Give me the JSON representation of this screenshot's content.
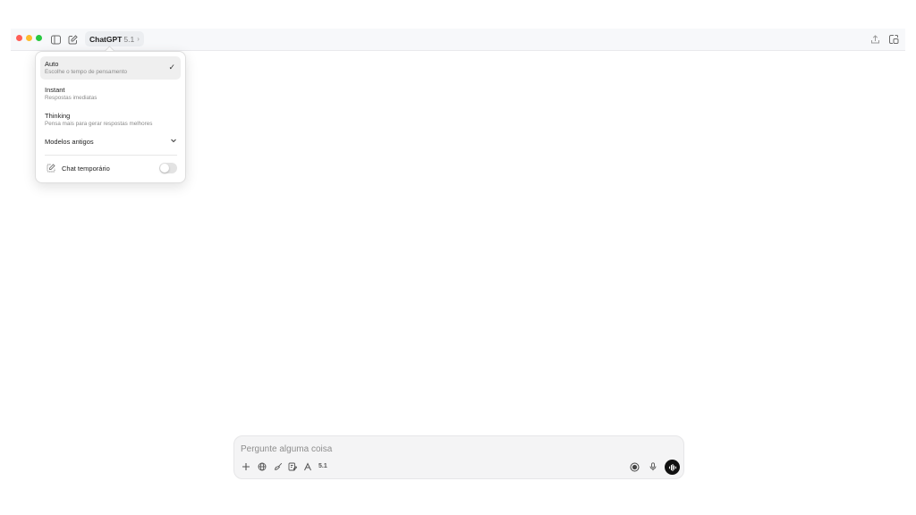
{
  "titlebar": {
    "model_name": "ChatGPT",
    "model_version": "5.1",
    "model_chevron": "›",
    "traffic_colors": {
      "close": "#ff5f57",
      "minimize": "#febc2e",
      "zoom": "#28c840"
    },
    "icons": [
      "sidebar-toggle-icon",
      "new-chat-icon",
      "share-icon",
      "new-window-icon"
    ]
  },
  "model_menu": {
    "options": [
      {
        "title": "Auto",
        "subtitle": "Escolhe o tempo de pensamento",
        "selected": true
      },
      {
        "title": "Instant",
        "subtitle": "Respostas imediatas",
        "selected": false
      },
      {
        "title": "Thinking",
        "subtitle": "Pensa mais para gerar respostas melhores",
        "selected": false
      }
    ],
    "check_glyph": "✓",
    "legacy_label": "Modelos antigos",
    "legacy_chevron": "⌄",
    "temporary_chat_label": "Chat temporário",
    "temporary_chat_enabled": false
  },
  "composer": {
    "placeholder": "Pergunte alguma coisa",
    "value": "",
    "model_badge": "5.1",
    "accent_color": "#111111",
    "tools": [
      "plus-icon",
      "globe-icon",
      "paint-icon",
      "canvas-icon",
      "agent-icon"
    ],
    "right_icons": [
      "record-icon",
      "microphone-icon",
      "voice-mode-icon"
    ]
  }
}
